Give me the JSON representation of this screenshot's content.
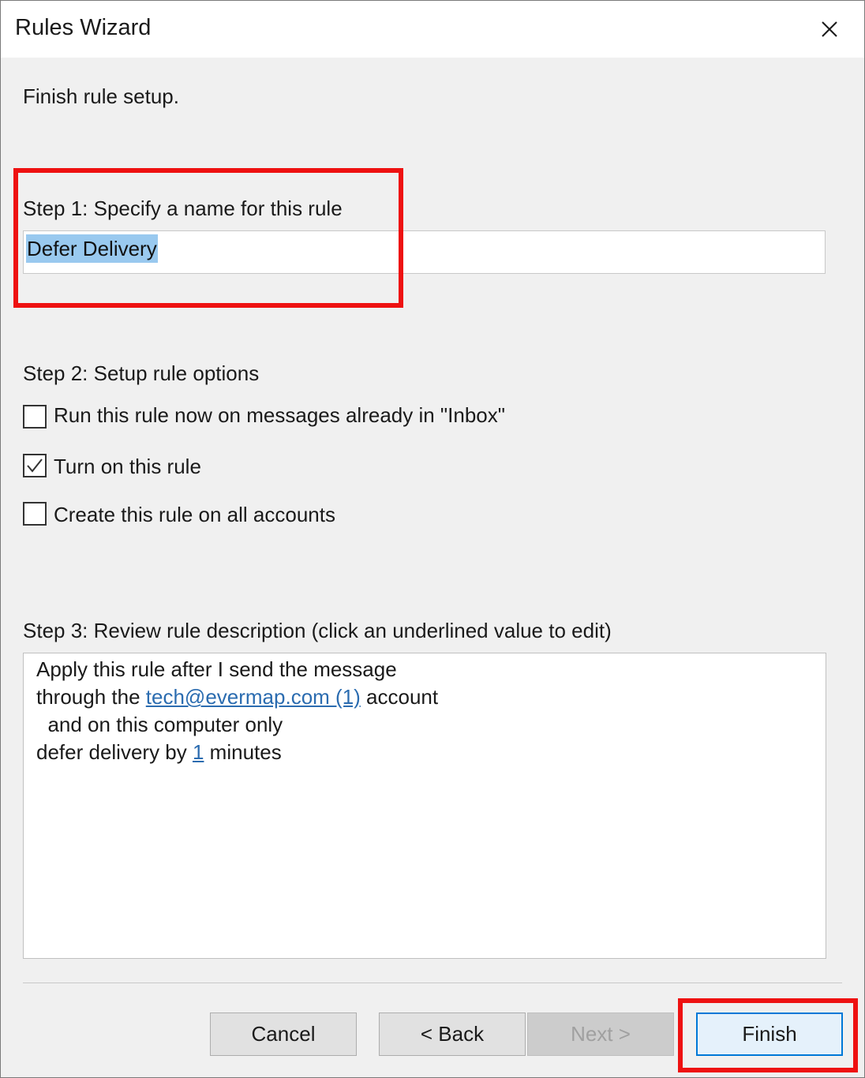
{
  "window": {
    "title": "Rules Wizard"
  },
  "header": {
    "instruction": "Finish rule setup."
  },
  "step1": {
    "label": "Step 1: Specify a name for this rule",
    "rule_name": "Defer Delivery"
  },
  "step2": {
    "label": "Step 2: Setup rule options",
    "options": [
      {
        "label": "Run this rule now on messages already in \"Inbox\"",
        "checked": false
      },
      {
        "label": "Turn on this rule",
        "checked": true
      },
      {
        "label": "Create this rule on all accounts",
        "checked": false
      }
    ]
  },
  "step3": {
    "label": "Step 3: Review rule description (click an underlined value to edit)",
    "line1": "Apply this rule after I send the message",
    "line2_prefix": "through the ",
    "line2_link": "tech@evermap.com (1)",
    "line2_suffix": " account",
    "line3": "  and on this computer only",
    "line4_prefix": "defer delivery by ",
    "line4_link": "1",
    "line4_suffix": " minutes"
  },
  "buttons": {
    "cancel": "Cancel",
    "back": "< Back",
    "next": "Next >",
    "finish": "Finish"
  },
  "colors": {
    "highlight": "#ee1111",
    "link": "#2b6cb0",
    "selection": "#99c9ef"
  }
}
